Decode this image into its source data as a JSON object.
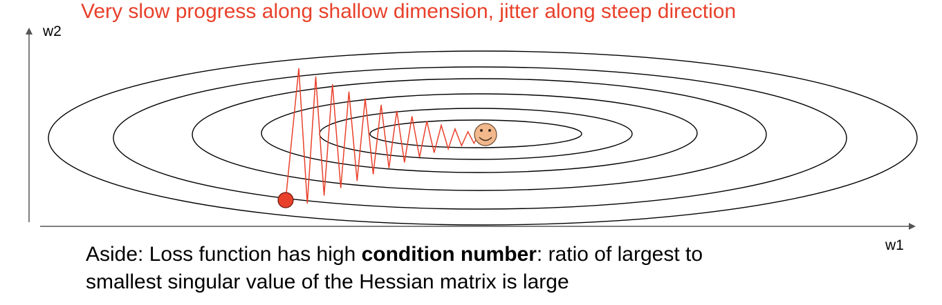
{
  "title": "Very slow progress along shallow dimension, jitter along steep direction",
  "axes": {
    "x_label": "w1",
    "y_label": "w2"
  },
  "note": {
    "prefix": "Aside: Loss function has high ",
    "bold": "condition number",
    "middle": ": ratio of largest to",
    "line2": "smallest singular value of the Hessian matrix is large"
  },
  "colors": {
    "path": "#e8402a",
    "start_dot": "#e8402a",
    "contour": "#000000",
    "smiley_face": "#f2b88c"
  },
  "icons": {
    "minimum": "smiley-face-icon",
    "start": "start-point-icon"
  }
}
